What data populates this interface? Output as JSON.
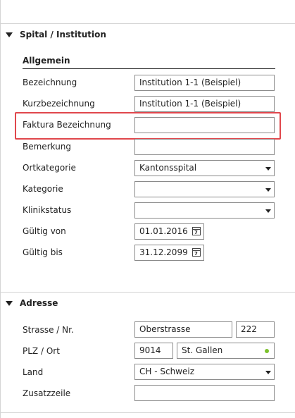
{
  "sections": {
    "spital": {
      "title": "Spital / Institution"
    },
    "adresse": {
      "title": "Adresse"
    }
  },
  "allgemein": {
    "title": "Allgemein",
    "bezeichnung": {
      "label": "Bezeichnung",
      "value": "Institution 1-1 (Beispiel)"
    },
    "kurzbezeichnung": {
      "label": "Kurzbezeichnung",
      "value": "Institution 1-1 (Beispiel)"
    },
    "faktura": {
      "label": "Faktura Bezeichnung",
      "value": ""
    },
    "bemerkung": {
      "label": "Bemerkung",
      "value": ""
    },
    "ortkategorie": {
      "label": "Ortkategorie",
      "value": "Kantonsspital"
    },
    "kategorie": {
      "label": "Kategorie",
      "value": ""
    },
    "klinikstatus": {
      "label": "Klinikstatus",
      "value": ""
    },
    "gueltig_von": {
      "label": "Gültig von",
      "value": "01.01.2016"
    },
    "gueltig_bis": {
      "label": "Gültig bis",
      "value": "31.12.2099"
    }
  },
  "adresse": {
    "strasse": {
      "label": "Strasse / Nr.",
      "value": "Oberstrasse",
      "nr": "222"
    },
    "plz": {
      "label": "PLZ / Ort",
      "value": "9014",
      "ort": "St. Gallen"
    },
    "land": {
      "label": "Land",
      "value": "CH - Schweiz"
    },
    "zusatz": {
      "label": "Zusatzzeile",
      "value": ""
    }
  },
  "icons": {
    "calendar": "calendar-icon",
    "dropdown": "chevron-down-icon",
    "status": "status-dot-icon"
  },
  "colors": {
    "highlight": "#e0474c",
    "status_dot": "#7cc22c",
    "border": "#8a8a8a"
  }
}
